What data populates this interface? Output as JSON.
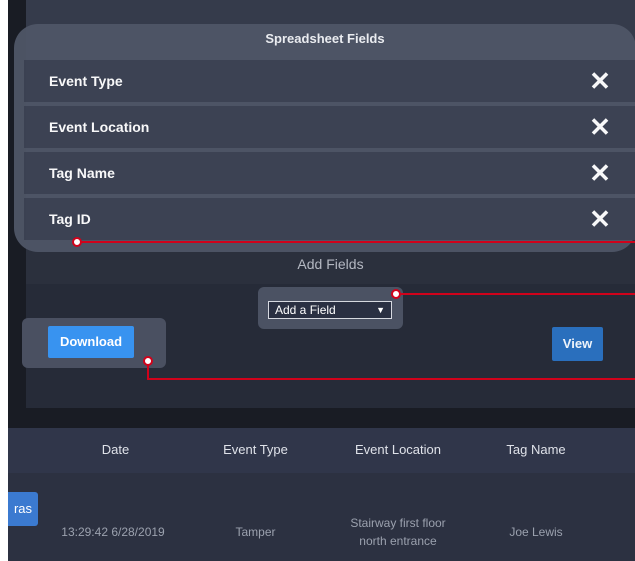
{
  "fields_panel": {
    "title": "Spreadsheet Fields",
    "fields": [
      {
        "label": "Event Type"
      },
      {
        "label": "Event Location"
      },
      {
        "label": "Tag Name"
      },
      {
        "label": "Tag ID"
      }
    ],
    "remove_icon": "close-icon"
  },
  "add_fields": {
    "label": "Add Fields",
    "select_value": "Add a Field"
  },
  "buttons": {
    "download": "Download",
    "view": "View"
  },
  "table": {
    "side_tab": "ras",
    "headers": [
      "Date",
      "Event Type",
      "Event Location",
      "Tag Name"
    ],
    "row": {
      "date": "13:29:42 6/28/2019",
      "event_type": "Tamper",
      "event_location_line1": "Stairway first floor",
      "event_location_line2": "north entrance",
      "tag_name": "Joe Lewis"
    }
  },
  "colors": {
    "accent_blue": "#3893f0",
    "view_blue": "#2a6fbd",
    "callout_red": "#d0021b"
  }
}
